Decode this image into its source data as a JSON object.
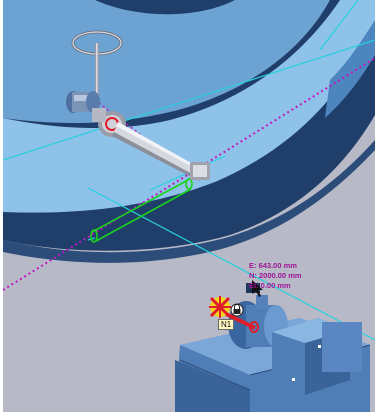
{
  "viewport": {
    "background": "#b7b9c6",
    "description_colors": {
      "tank_dark": "#203e6a",
      "tank_mid": "#5e93c6",
      "tank_light": "#8ec2e8",
      "guide_line": "#26d0df",
      "route_line": "#c217c2",
      "selection_green": "#1bd21b",
      "pipe_red": "#e11c2a",
      "equipment_blue": "#4f7eb6"
    }
  },
  "coordinates": {
    "e_line": "E: 643.00 mm",
    "n_line": "N: 2000.00 mm",
    "el_line": "El: 0.00 mm"
  },
  "node_label": "N1",
  "icons": {
    "handwheel": "handwheel-icon",
    "snap_point": "snap-point-icon",
    "lock": "lock-icon",
    "cursor": "cursor-icon"
  }
}
